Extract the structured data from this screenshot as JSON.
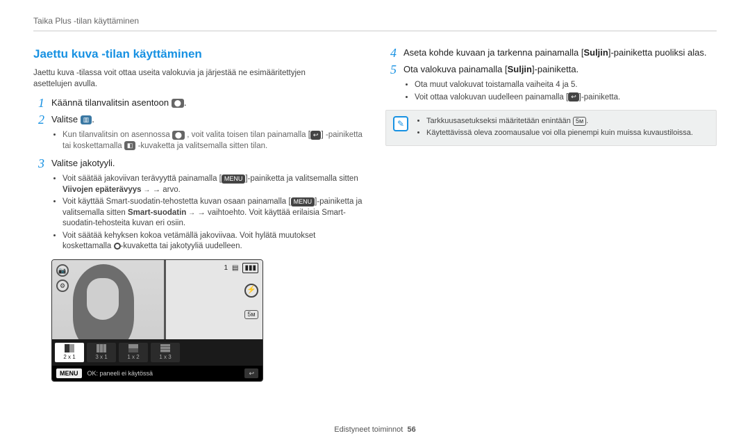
{
  "breadcrumb": "Taika Plus -tilan käyttäminen",
  "left": {
    "title": "Jaettu kuva -tilan käyttäminen",
    "intro": "Jaettu kuva -tilassa voit ottaa useita valokuvia ja järjestää ne esimääritettyjen asettelujen avulla.",
    "steps": {
      "s1_text": "Käännä tilanvalitsin asentoon",
      "s2_text": "Valitse",
      "s2_bullet_a": "Kun tilanvalitsin on asennossa",
      "s2_bullet_b": ", voit valita toisen tilan painamalla",
      "s2_bullet_c": "-painiketta tai koskettamalla",
      "s2_bullet_d": "-kuvaketta ja valitsemalla sitten tilan.",
      "s3_text": "Valitse jakotyyli.",
      "s3_b1a": "Voit säätää jakoviivan terävyyttä painamalla [",
      "s3_b1b": "]-painiketta ja valitsemalla sitten ",
      "s3_b1c_bold": "Viivojen epäterävyys",
      "s3_b1d": " → arvo.",
      "s3_b2a": "Voit käyttää Smart-suodatin-tehostetta kuvan osaan painamalla [",
      "s3_b2b": "]-painiketta ja valitsemalla sitten ",
      "s3_b2c_bold": "Smart-suodatin",
      "s3_b2d": " → vaihtoehto. Voit käyttää erilaisia Smart-suodatin-tehosteita kuvan eri osiin.",
      "s3_b3": "Voit säätää kehyksen kokoa vetämällä jakoviivaa. Voit hylätä muutokset koskettamalla ",
      "s3_b3b": "-kuvaketta tai jakotyyliä uudelleen."
    }
  },
  "right": {
    "s4a": "Aseta kohde kuvaan ja tarkenna painamalla [",
    "s4_bold": "Suljin",
    "s4b": "]-painiketta puoliksi alas.",
    "s5a": "Ota valokuva painamalla [",
    "s5_bold": "Suljin",
    "s5b": "]-painiketta.",
    "s5_sub1": "Ota muut valokuvat toistamalla vaiheita 4 ja 5.",
    "s5_sub2a": "Voit ottaa valokuvan uudelleen painamalla [",
    "s5_sub2b": "]-painiketta.",
    "note1a": "Tarkkuusasetukseksi määritetään enintään ",
    "note1b": ".",
    "note2": "Käytettävissä oleva zoomausalue voi olla pienempi kuin muissa kuvaustiloissa."
  },
  "preview": {
    "opts": [
      "2 x 1",
      "3 x 1",
      "1 x 2",
      "1 x 3"
    ],
    "menu": "MENU",
    "status": "OK: paneeli ei käytössä",
    "count": "1",
    "menu_label_inline": "MENU"
  },
  "footer_label": "Edistyneet toiminnot",
  "footer_page": "56"
}
